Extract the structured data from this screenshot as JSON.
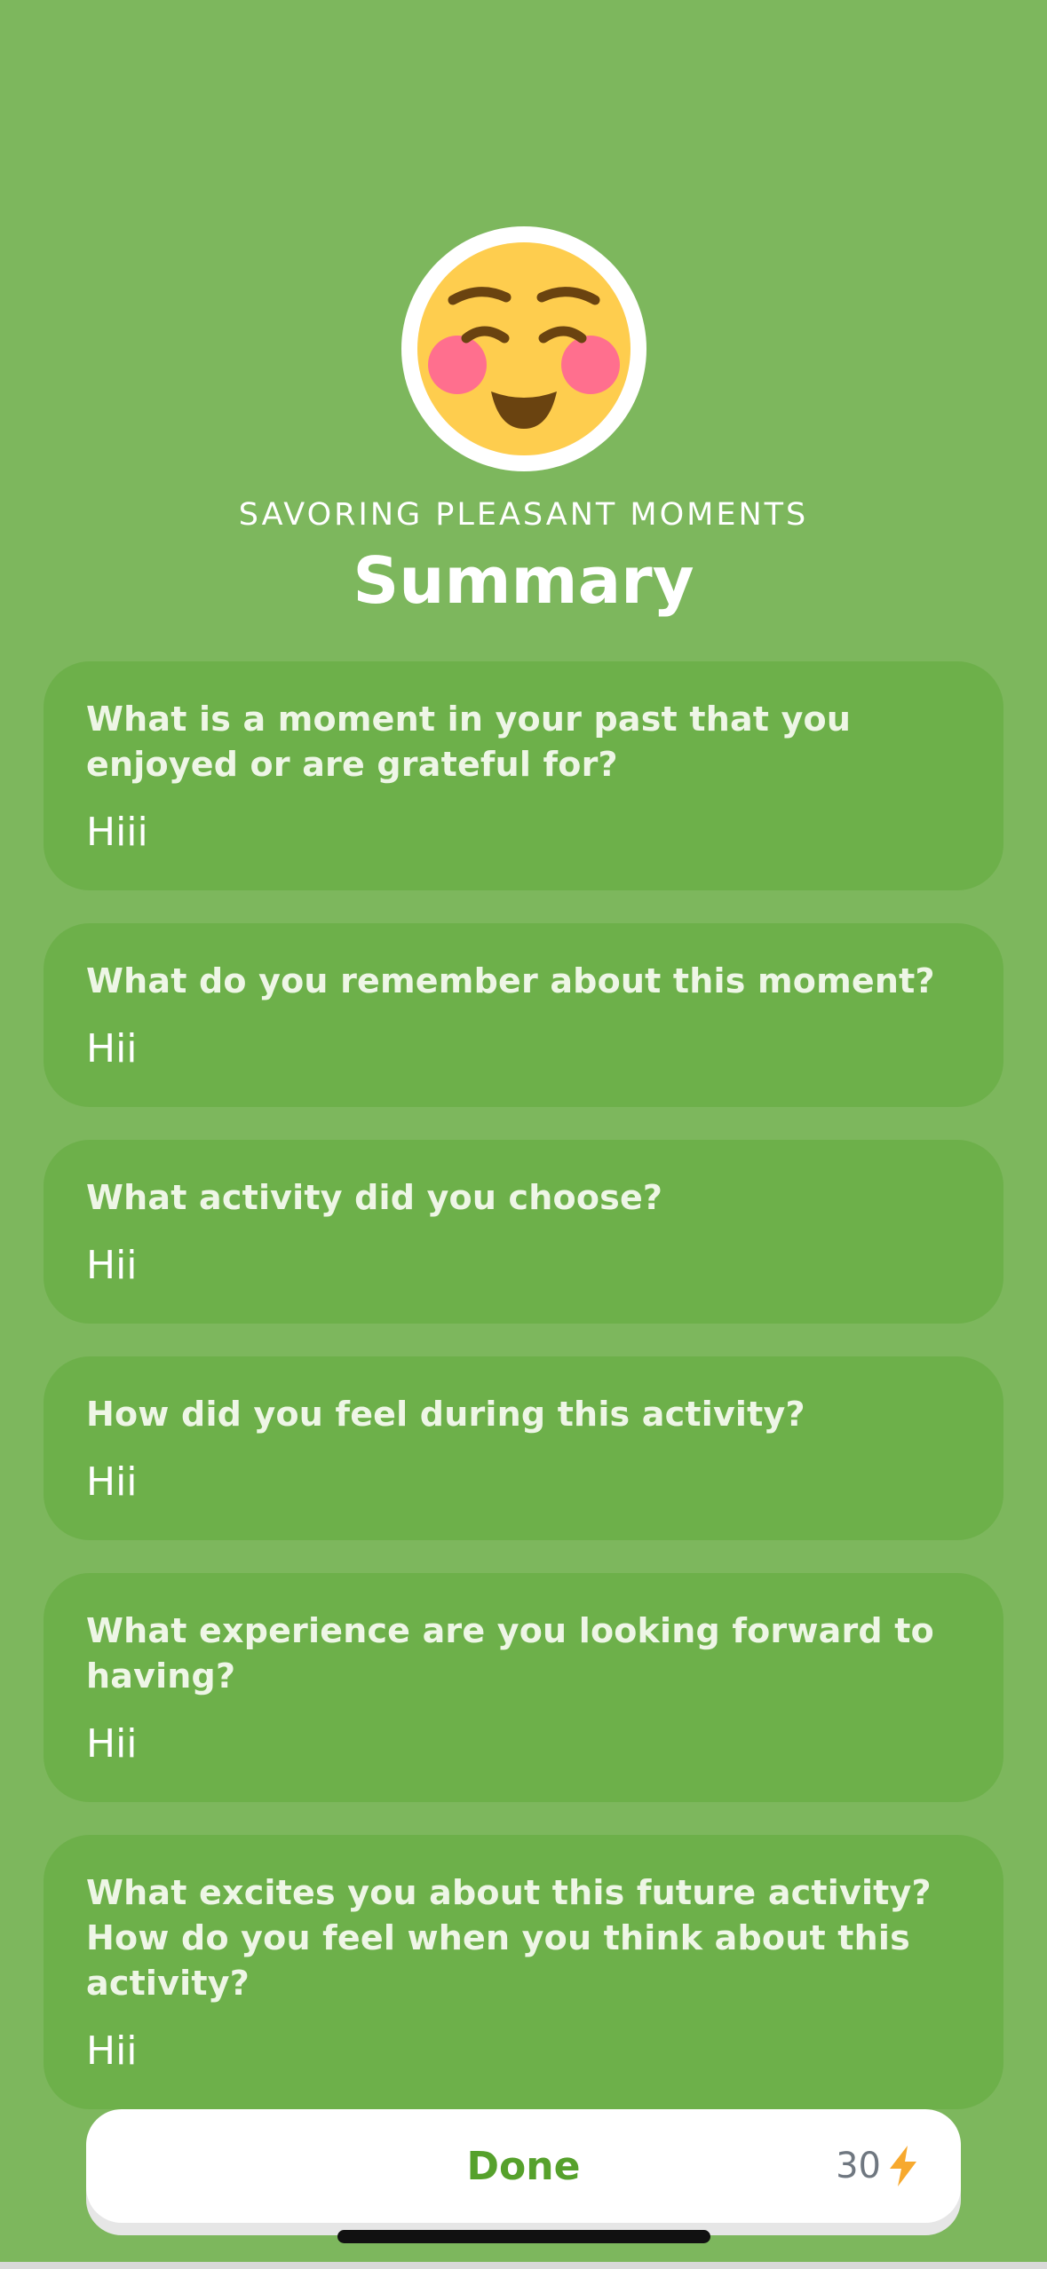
{
  "header": {
    "eyebrow": "SAVORING PLEASANT MOMENTS",
    "title": "Summary",
    "emoji_icon": "smiling-face-with-blushing-cheeks-icon"
  },
  "cards": [
    {
      "question": "What is a moment in your past that you enjoyed or are grateful for?",
      "answer": "Hiii"
    },
    {
      "question": "What do you remember about this moment?",
      "answer": "Hii"
    },
    {
      "question": "What activity did you choose?",
      "answer": "Hii"
    },
    {
      "question": "How did you feel during this activity?",
      "answer": "Hii"
    },
    {
      "question": "What experience are you looking forward to having?",
      "answer": "Hii"
    },
    {
      "question": "What excites you about this future activity? How do you feel when you think about this activity?",
      "answer": "Hii"
    }
  ],
  "footer": {
    "done_label": "Done",
    "points": "30",
    "points_icon": "lightning-bolt-icon"
  },
  "colors": {
    "background": "#7db75d",
    "card": "#6db04a",
    "done_text": "#56a12c",
    "bolt": "#f7a92e"
  }
}
